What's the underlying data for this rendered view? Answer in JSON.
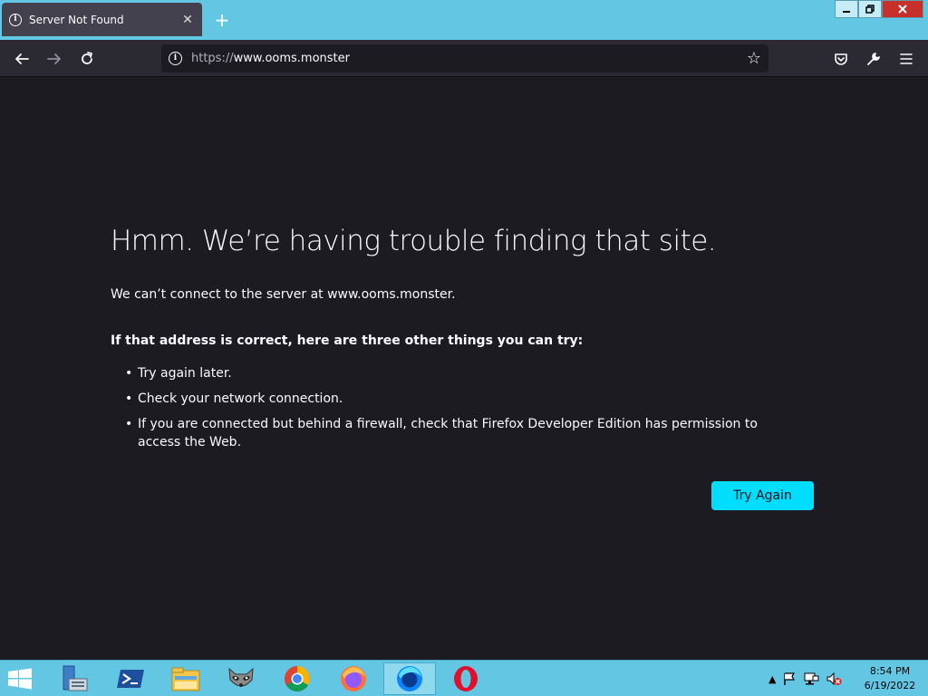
{
  "browser": {
    "tab_title": "Server Not Found",
    "url_scheme": "https://",
    "url_host": "www.ooms.monster"
  },
  "error": {
    "title": "Hmm. We’re having trouble finding that site.",
    "description": "We can’t connect to the server at www.ooms.monster.",
    "suggestions_heading": "If that address is correct, here are three other things you can try:",
    "suggestions": [
      "Try again later.",
      "Check your network connection.",
      "If you are connected but behind a firewall, check that Firefox Developer Edition has permission to access the Web."
    ],
    "try_again_label": "Try Again"
  },
  "taskbar": {
    "apps": [
      "server-manager-icon",
      "powershell-icon",
      "file-explorer-icon",
      "raccoon-app-icon",
      "chrome-icon",
      "firefox-icon",
      "firefox-developer-edition-icon",
      "opera-icon"
    ],
    "time": "8:54 PM",
    "date": "6/19/2022"
  },
  "colors": {
    "page_bg": "#1c1b22",
    "toolbar_bg": "#2b2a33",
    "accent": "#00ddff",
    "titlebar": "#63c7e4"
  }
}
